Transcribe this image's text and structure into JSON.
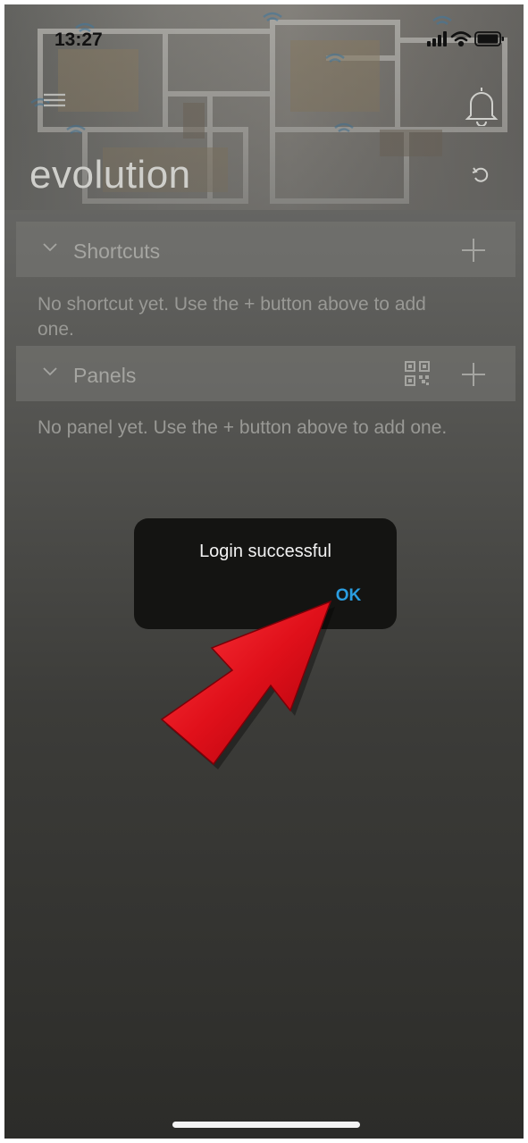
{
  "status_bar": {
    "time": "13:27"
  },
  "header": {
    "title": "evolution"
  },
  "sections": {
    "shortcuts": {
      "label": "Shortcuts",
      "empty_text": "No shortcut yet. Use the + button above to add one."
    },
    "panels": {
      "label": "Panels",
      "empty_text": "No panel yet. Use the + button above to add one."
    }
  },
  "dialog": {
    "message": "Login successful",
    "ok_label": "OK"
  },
  "colors": {
    "accent": "#2a9de0",
    "annotation_arrow": "#e0101a",
    "dialog_bg": "#141412"
  },
  "icons": [
    "menu-icon",
    "bell-icon",
    "refresh-icon",
    "chevron-down-icon",
    "plus-icon",
    "qr-code-icon",
    "signal-icon",
    "wifi-icon",
    "battery-icon"
  ]
}
